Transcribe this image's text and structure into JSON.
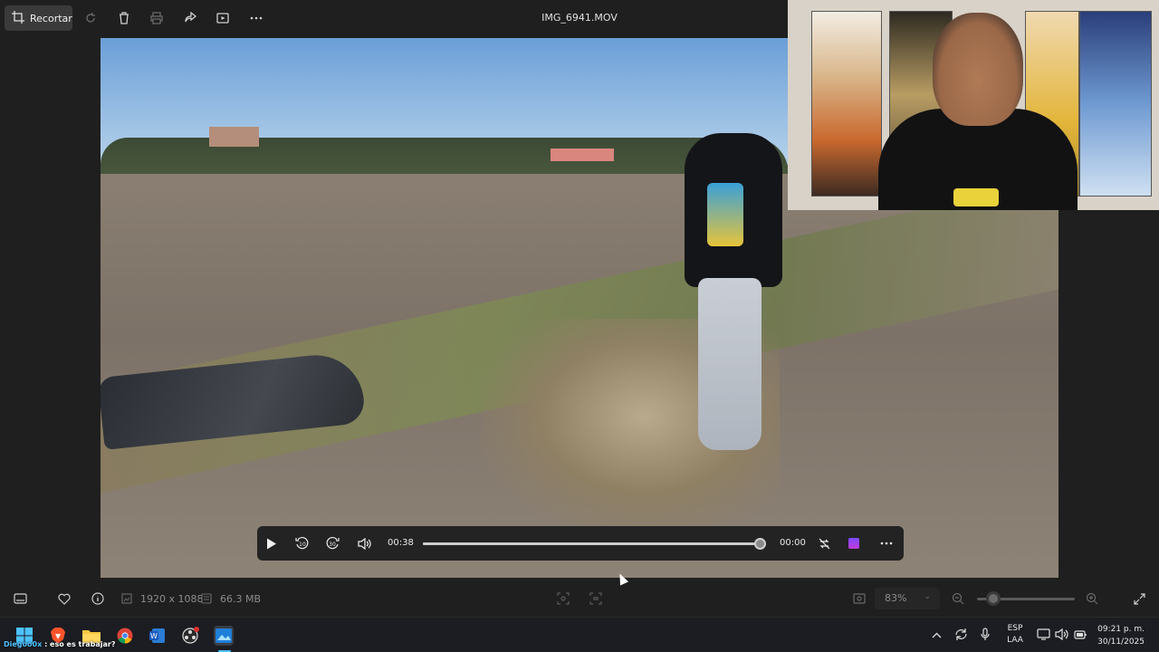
{
  "toolbar": {
    "crop_label": "Recortar",
    "file_title": "IMG_6941.MOV",
    "icons": [
      "crop-icon",
      "rotate-icon",
      "delete-icon",
      "print-icon",
      "share-icon",
      "slideshow-icon",
      "more-icon"
    ]
  },
  "player": {
    "current_time": "00:38",
    "remaining_time": "00:00",
    "progress": 0.98,
    "skip_back_label": "10",
    "skip_forward_label": "30",
    "icons": [
      "play-icon",
      "skip-back-10-icon",
      "skip-forward-30-icon",
      "volume-icon",
      "loop-off-icon",
      "clipchamp-icon",
      "more-icon"
    ]
  },
  "info_bar": {
    "dimensions": "1920 x 1088",
    "file_size": "66.3 MB",
    "zoom": "83%",
    "zoom_level": 0.1
  },
  "taskbar": {
    "subtitle_name": "Diegoo0x",
    "subtitle_text": ": eso es trabajar?",
    "language_line1": "ESP",
    "language_line2": "LAA",
    "time": "09:21 p. m.",
    "date": "30/11/2025"
  }
}
